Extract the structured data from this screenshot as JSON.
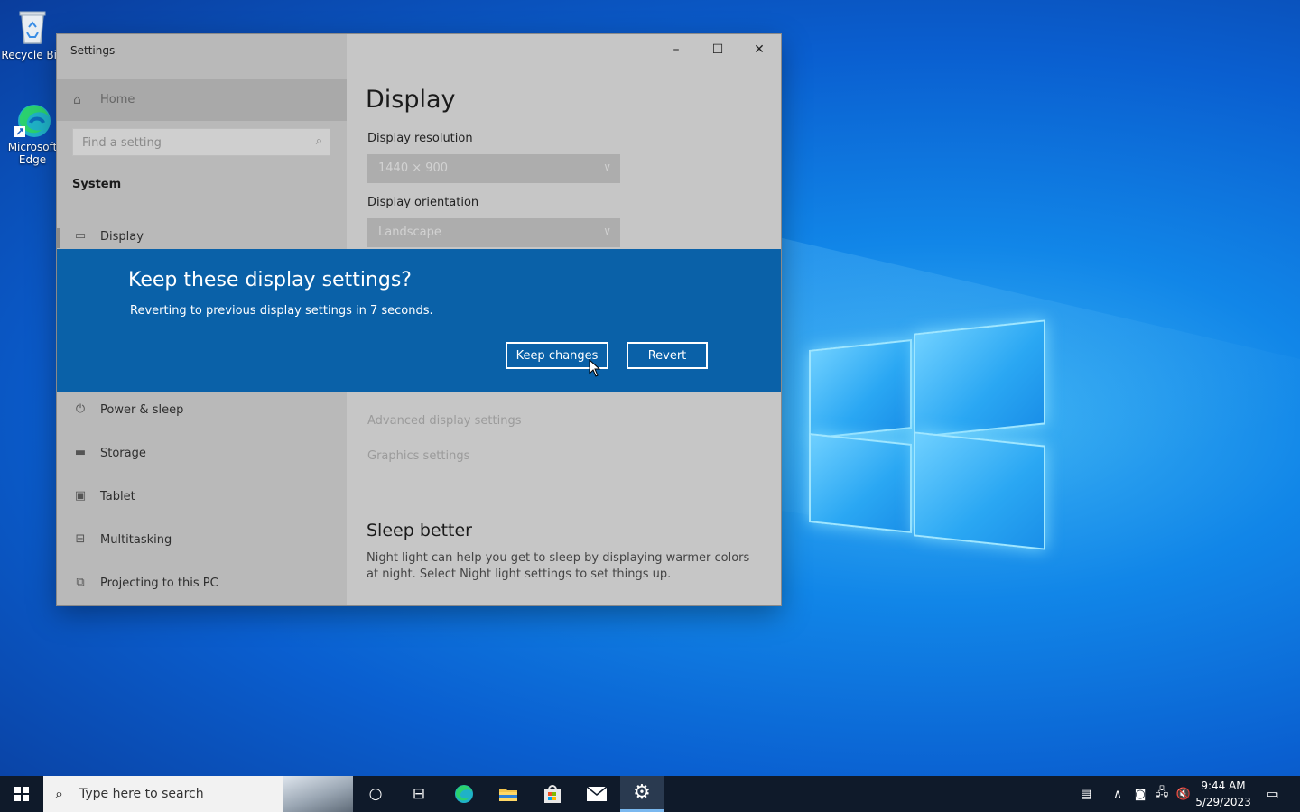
{
  "desktop": {
    "icons": [
      {
        "label": "Recycle Bin",
        "icon": "recycle-bin-icon"
      },
      {
        "label": "Microsoft Edge",
        "icon": "edge-icon"
      }
    ]
  },
  "window": {
    "title": "Settings",
    "controls": {
      "minimize": "–",
      "maximize": "☐",
      "close": "✕"
    }
  },
  "sidebar": {
    "home": "Home",
    "search_placeholder": "Find a setting",
    "section": "System",
    "items": [
      {
        "label": "Display",
        "icon": "monitor-icon"
      },
      {
        "label": "Power & sleep",
        "icon": "power-icon"
      },
      {
        "label": "Storage",
        "icon": "storage-icon"
      },
      {
        "label": "Tablet",
        "icon": "tablet-icon"
      },
      {
        "label": "Multitasking",
        "icon": "multitasking-icon"
      },
      {
        "label": "Projecting to this PC",
        "icon": "projecting-icon"
      }
    ]
  },
  "main": {
    "title": "Display",
    "resolution_label": "Display resolution",
    "resolution_value": "1440 × 900",
    "orientation_label": "Display orientation",
    "orientation_value": "Landscape",
    "advanced_link": "Advanced display settings",
    "graphics_link": "Graphics settings",
    "sleep_heading": "Sleep better",
    "sleep_text": "Night light can help you get to sleep by displaying warmer colors at night. Select Night light settings to set things up."
  },
  "dialog": {
    "heading": "Keep these display settings?",
    "message": "Reverting to previous display settings in  7 seconds.",
    "keep_label": "Keep changes",
    "revert_label": "Revert",
    "accent": "#0a61a8"
  },
  "taskbar": {
    "search_placeholder": "Type here to search",
    "time": "9:44 AM",
    "date": "5/29/2023",
    "notification_count": "1"
  }
}
